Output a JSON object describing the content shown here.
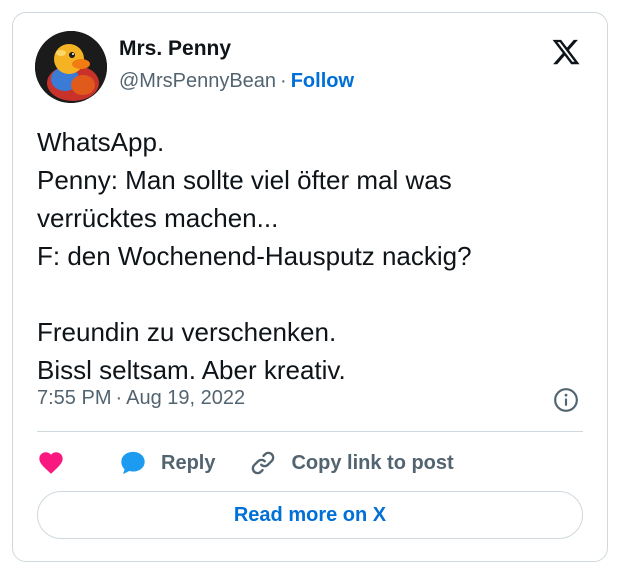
{
  "author": {
    "name": "Mrs. Penny",
    "handle": "@MrsPennyBean",
    "separator": "·",
    "follow_label": "Follow",
    "avatar_icon": "rubber-duck-avatar"
  },
  "tweet": {
    "lines": [
      "WhatsApp.",
      "Penny: Man sollte viel öfter mal was",
      "verrücktes machen...",
      "F: den Wochenend-Hausputz nackig?",
      "",
      "Freundin zu verschenken.",
      "Bissl seltsam. Aber kreativ."
    ],
    "time": "7:55 PM",
    "separator": "·",
    "date": "Aug 19, 2022"
  },
  "actions": {
    "like_icon": "heart-icon",
    "reply_label": "Reply",
    "reply_icon": "speech-bubble-icon",
    "copy_label": "Copy link to post",
    "copy_icon": "link-icon"
  },
  "read_more_label": "Read more on X",
  "colors": {
    "accent": "#006fd6",
    "like": "#f91880",
    "reply": "#1d9bf0",
    "muted": "#536471",
    "border": "#cfd9de",
    "text": "#0f1419"
  }
}
